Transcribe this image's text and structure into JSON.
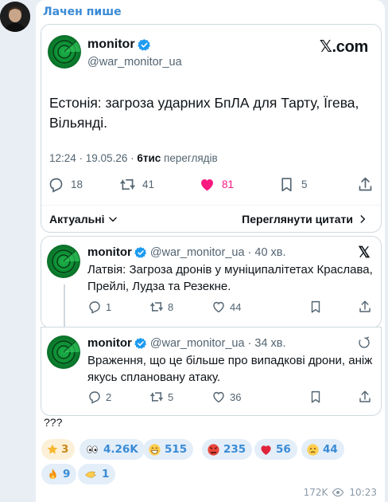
{
  "message": {
    "sender": "Лачен пише",
    "tweet": {
      "name": "monitor",
      "handle": "@war_monitor_ua",
      "source": "𝕏.com",
      "text": "Естонія: загроза ударних БпЛА для Тарту, Їгева, Вільянді.",
      "time": "12:24 · 19.05.26 · ",
      "views_count": "6тис",
      "views_label": " переглядів",
      "replies": "18",
      "retweets": "41",
      "likes": "81",
      "bookmarks": "5",
      "current_label": "Актуальні",
      "quotes_label": "Переглянути цитати"
    },
    "replies_list": [
      {
        "name": "monitor",
        "handle": "@war_monitor_ua · 40 хв.",
        "text": "Латвія: Загроза дронів у муніципалітетах Краслава, Прейлі, Лудза та Резекне.",
        "replies": "1",
        "retweets": "8",
        "likes": "44"
      },
      {
        "name": "monitor",
        "handle": "@war_monitor_ua · 34 хв.",
        "text": "Враження, що це більше про випадкові дрони, аніж якусь сплановану атаку.",
        "replies": "2",
        "retweets": "5",
        "likes": "36"
      }
    ],
    "caption": "???",
    "reactions": [
      {
        "emoji": "star",
        "count": "3"
      },
      {
        "emoji": "eyes",
        "count": "4.26K"
      },
      {
        "emoji": "grin",
        "count": "515"
      },
      {
        "emoji": "angry",
        "count": "235"
      },
      {
        "emoji": "heart",
        "count": "56"
      },
      {
        "emoji": "cry",
        "count": "44"
      },
      {
        "emoji": "fire",
        "count": "9"
      },
      {
        "emoji": "fingers-crossed",
        "count": "1"
      }
    ],
    "views": "172K",
    "sent_time": "10:23"
  },
  "colors": {
    "accent": "#3a8bd6",
    "like": "#f91880",
    "verified": "#1d9bf0"
  }
}
